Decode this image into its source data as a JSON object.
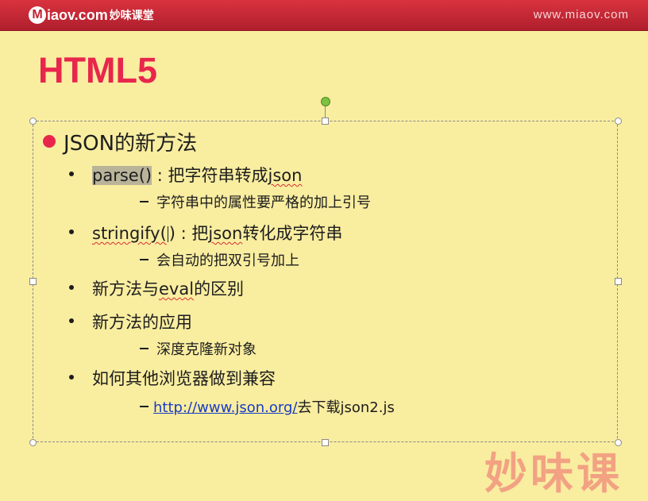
{
  "header": {
    "logo_mark": "M",
    "logo_text": "iaov.com",
    "logo_cn": "妙味课堂",
    "site_url": "www.miaov.com"
  },
  "slide": {
    "title": "HTML5",
    "heading": "JSON的新方法",
    "items": [
      {
        "pre": "parse()",
        "rest": " : 把字符串转成",
        "word": "json"
      },
      {
        "sub": "字符串中的属性要严格的加上引号"
      },
      {
        "pre": "stringify(",
        "post": ") : 把",
        "word": "json",
        "rest": "转化成字符串"
      },
      {
        "sub": "会自动的把双引号加上"
      },
      {
        "pre": "新方法与",
        "word": "eval",
        "rest": "的区别"
      },
      {
        "text": "新方法的应用"
      },
      {
        "sub": "深度克隆新对象"
      },
      {
        "text": "如何其他浏览器做到兼容"
      },
      {
        "link": "http://www.json.org/",
        "rest": "去下载json2.js"
      }
    ]
  },
  "watermark": "妙味课",
  "colors": {
    "title": "#e8264c",
    "topbar": "#c42030",
    "background": "#f9eda0",
    "link": "#1a3cc4"
  }
}
